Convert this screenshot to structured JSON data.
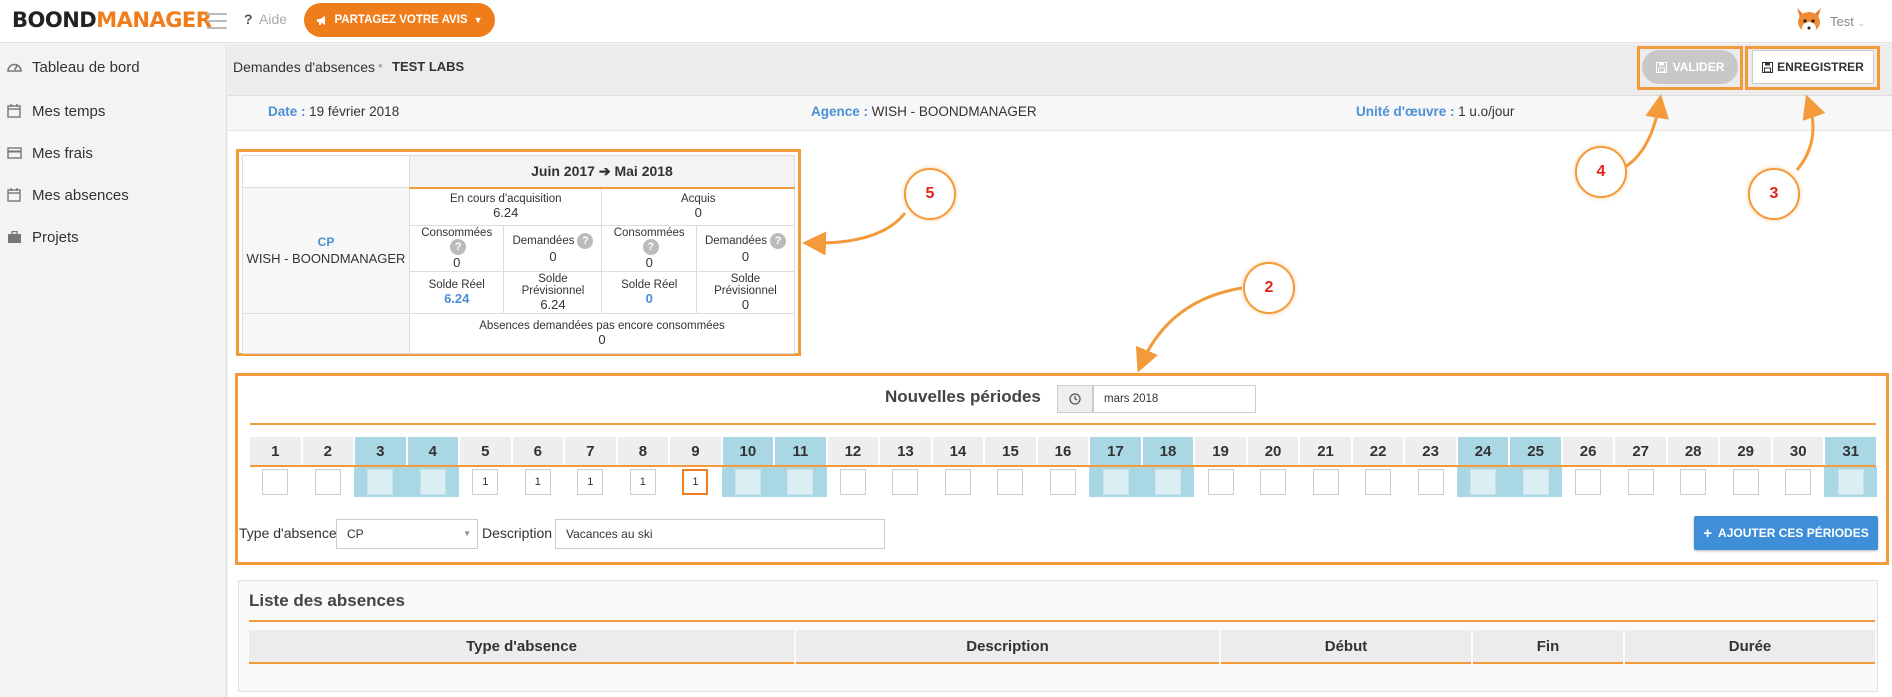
{
  "brand": {
    "part1": "BOOND",
    "part2": "MANAGER"
  },
  "topbar": {
    "help_label": "Aide",
    "share_label": "PARTAGEZ VOTRE AVIS",
    "user_name": "Test"
  },
  "sidebar": {
    "items": [
      {
        "label": "Tableau de bord",
        "icon": "dashboard-icon"
      },
      {
        "label": "Mes temps",
        "icon": "calendar-icon"
      },
      {
        "label": "Mes frais",
        "icon": "credit-card-icon"
      },
      {
        "label": "Mes absences",
        "icon": "calendar-icon"
      },
      {
        "label": "Projets",
        "icon": "briefcase-icon"
      }
    ]
  },
  "header": {
    "breadcrumb_1": "Demandes d'absences",
    "breadcrumb_sep": "•",
    "breadcrumb_2": "TEST LABS",
    "valider_label": "VALIDER",
    "enregistrer_label": "ENREGISTRER"
  },
  "info": {
    "date_label": "Date :",
    "date_value": "19 février 2018",
    "agence_label": "Agence :",
    "agence_value": "WISH - BOONDMANAGER",
    "unite_label": "Unité d'œuvre :",
    "unite_value": "1 u.o/jour"
  },
  "balance": {
    "period": "Juin 2017 ➔ Mai 2018",
    "type": "CP",
    "agency": "WISH - BOONDMANAGER",
    "en_cours_label": "En cours d'acquisition",
    "en_cours_value": "6.24",
    "acquis_label": "Acquis",
    "acquis_value": "0",
    "consommees_label": "Consommées",
    "demandees_label": "Demandées",
    "c1": "0",
    "d1": "0",
    "c2": "0",
    "d2": "0",
    "solde_reel_label": "Solde Réel",
    "solde_prev_label": "Solde Prévisionnel",
    "sr1": "6.24",
    "sp1": "6.24",
    "sr2": "0",
    "sp2": "0",
    "pending_label": "Absences demandées pas encore consommées",
    "pending_value": "0"
  },
  "periods": {
    "title": "Nouvelles périodes",
    "month_value": "mars 2018",
    "days": [
      "1",
      "2",
      "3",
      "4",
      "5",
      "6",
      "7",
      "8",
      "9",
      "10",
      "11",
      "12",
      "13",
      "14",
      "15",
      "16",
      "17",
      "18",
      "19",
      "20",
      "21",
      "22",
      "23",
      "24",
      "25",
      "26",
      "27",
      "28",
      "29",
      "30",
      "31"
    ],
    "weekend_days": [
      3,
      4,
      10,
      11,
      17,
      18,
      24,
      25,
      31
    ],
    "values": [
      "",
      "",
      "",
      "",
      "1",
      "1",
      "1",
      "1",
      "1",
      "",
      "",
      "",
      "",
      "",
      "",
      "",
      "",
      "",
      "",
      "",
      "",
      "",
      "",
      "",
      "",
      "",
      "",
      "",
      "",
      "",
      ""
    ],
    "active_day": 9,
    "type_label": "Type d'absence",
    "type_value": "CP",
    "description_label": "Description",
    "description_value": "Vacances au ski",
    "add_label": "AJOUTER CES PÉRIODES"
  },
  "absences_list": {
    "title": "Liste des absences",
    "columns": [
      "Type d'absence",
      "Description",
      "Début",
      "Fin",
      "Durée"
    ]
  },
  "annotations": [
    "5",
    "2",
    "4",
    "3"
  ],
  "colors": {
    "accent": "#f07d1c",
    "link": "#4b8fd6",
    "weekend": "#a9d8e4",
    "primary_button": "#3f8fd8"
  }
}
